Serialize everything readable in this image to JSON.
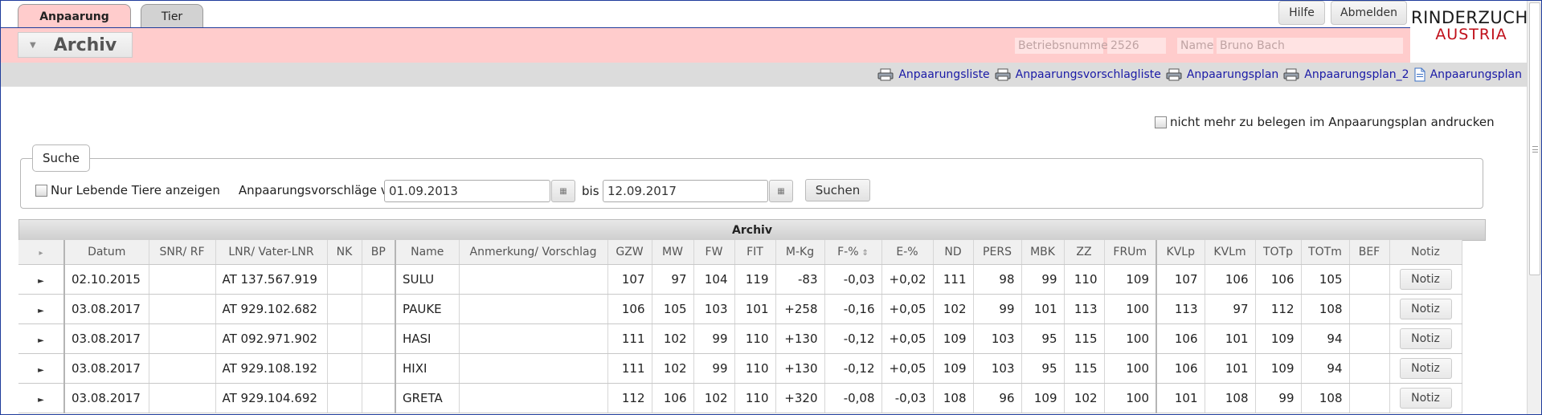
{
  "tabs": [
    {
      "label": "Anpaarung",
      "active": true
    },
    {
      "label": "Tier",
      "active": false
    }
  ],
  "top_buttons": {
    "help": "Hilfe",
    "logout": "Abmelden"
  },
  "logo": {
    "line1": "RINDERZUCHT",
    "line2": "AUSTRIA"
  },
  "header": {
    "title": "Archiv",
    "betriebsnummer_label": "Betriebsnummer",
    "betriebsnummer_value": "2526",
    "name_label": "Name",
    "name_value": "Bruno Bach"
  },
  "print_links": [
    "Anpaarungsliste",
    "Anpaarungsvorschlagliste",
    "Anpaarungsplan",
    "Anpaarungsplan_2",
    "Anpaarungsplan"
  ],
  "nomore_label": "nicht mehr zu belegen im Anpaarungsplan andrucken",
  "search": {
    "legend": "Suche",
    "living_label": "Nur Lebende Tiere anzeigen",
    "from_label": "Anpaarungsvorschläge von",
    "from_value": "01.09.2013",
    "to_label": "bis",
    "to_value": "12.09.2017",
    "button": "Suchen"
  },
  "grid": {
    "title": "Archiv",
    "columns": [
      "Datum",
      "SNR/ RF",
      "LNR/ Vater-LNR",
      "NK",
      "BP",
      "Name",
      "Anmerkung/ Vorschlag",
      "GZW",
      "MW",
      "FW",
      "FIT",
      "M-Kg",
      "F-%",
      "E-%",
      "ND",
      "PERS",
      "MBK",
      "ZZ",
      "FRUm",
      "KVLp",
      "KVLm",
      "TOTp",
      "TOTm",
      "BEF",
      "Notiz"
    ],
    "notiz_button": "Notiz",
    "rows": [
      {
        "datum": "02.10.2015",
        "snr": "",
        "lnr": "AT 137.567.919",
        "nk": "",
        "bp": "",
        "name": "SULU",
        "anm": "",
        "gzw": "107",
        "mw": "97",
        "fw": "104",
        "fit": "119",
        "mkg": "-83",
        "fp": "-0,03",
        "ep": "+0,02",
        "nd": "111",
        "pers": "98",
        "mbk": "99",
        "zz": "110",
        "frum": "109",
        "kvlp": "107",
        "kvlm": "106",
        "totp": "106",
        "totm": "105",
        "bef": ""
      },
      {
        "datum": "03.08.2017",
        "snr": "",
        "lnr": "AT 929.102.682",
        "nk": "",
        "bp": "",
        "name": "PAUKE",
        "anm": "",
        "gzw": "106",
        "mw": "105",
        "fw": "103",
        "fit": "101",
        "mkg": "+258",
        "fp": "-0,16",
        "ep": "+0,05",
        "nd": "102",
        "pers": "99",
        "mbk": "101",
        "zz": "113",
        "frum": "100",
        "kvlp": "113",
        "kvlm": "97",
        "totp": "112",
        "totm": "108",
        "bef": ""
      },
      {
        "datum": "03.08.2017",
        "snr": "",
        "lnr": "AT 092.971.902",
        "nk": "",
        "bp": "",
        "name": "HASI",
        "anm": "",
        "gzw": "111",
        "mw": "102",
        "fw": "99",
        "fit": "110",
        "mkg": "+130",
        "fp": "-0,12",
        "ep": "+0,05",
        "nd": "109",
        "pers": "103",
        "mbk": "95",
        "zz": "115",
        "frum": "100",
        "kvlp": "106",
        "kvlm": "101",
        "totp": "109",
        "totm": "94",
        "bef": ""
      },
      {
        "datum": "03.08.2017",
        "snr": "",
        "lnr": "AT 929.108.192",
        "nk": "",
        "bp": "",
        "name": "HIXI",
        "anm": "",
        "gzw": "111",
        "mw": "102",
        "fw": "99",
        "fit": "110",
        "mkg": "+130",
        "fp": "-0,12",
        "ep": "+0,05",
        "nd": "109",
        "pers": "103",
        "mbk": "95",
        "zz": "115",
        "frum": "100",
        "kvlp": "106",
        "kvlm": "101",
        "totp": "109",
        "totm": "94",
        "bef": ""
      },
      {
        "datum": "03.08.2017",
        "snr": "",
        "lnr": "AT 929.104.692",
        "nk": "",
        "bp": "",
        "name": "GRETA",
        "anm": "",
        "gzw": "112",
        "mw": "106",
        "fw": "102",
        "fit": "110",
        "mkg": "+320",
        "fp": "-0,08",
        "ep": "-0,03",
        "nd": "108",
        "pers": "96",
        "mbk": "109",
        "zz": "102",
        "frum": "100",
        "kvlp": "101",
        "kvlm": "108",
        "totp": "99",
        "totm": "108",
        "bef": ""
      }
    ]
  }
}
